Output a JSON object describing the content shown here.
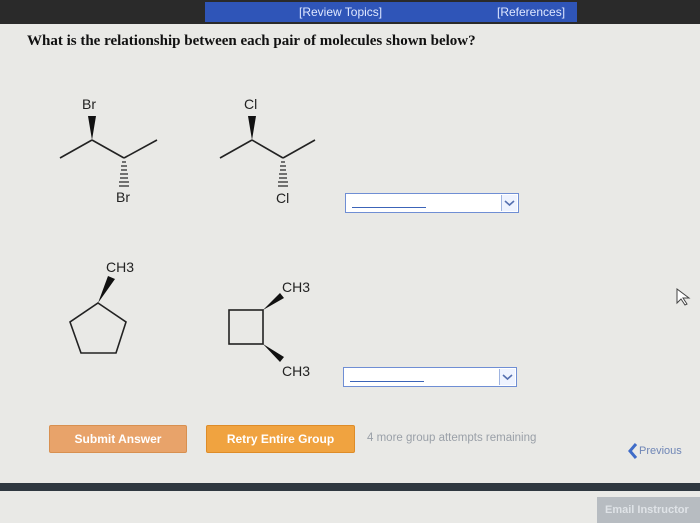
{
  "nav": {
    "review_topics": "[Review Topics]",
    "references": "[References]"
  },
  "question": "What is the relationship between each pair of molecules shown below?",
  "pair1": {
    "mol1": {
      "top_label": "Br",
      "bottom_label": "Br"
    },
    "mol2": {
      "top_label": "Cl",
      "bottom_label": "Cl"
    }
  },
  "pair2": {
    "mol1": {
      "label": "CH3"
    },
    "mol2": {
      "top_label": "CH3",
      "bottom_label": "CH3"
    }
  },
  "buttons": {
    "submit": "Submit Answer",
    "retry": "Retry Entire Group"
  },
  "attempts_remaining": "4 more group attempts remaining",
  "previous": "Previous",
  "email": "Email Instructor",
  "colors": {
    "nav_bg": "#2f55b8",
    "submit_bg": "#e8a36a",
    "retry_bg": "#f0a340",
    "select_border": "#6f8ed4"
  }
}
